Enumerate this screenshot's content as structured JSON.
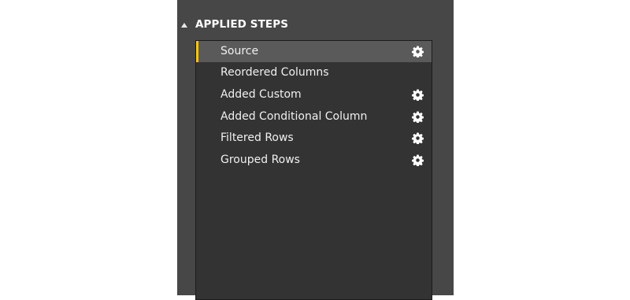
{
  "panel": {
    "title": "APPLIED STEPS",
    "collapse_icon": "triangle-up-icon",
    "accent_color": "#f2c811"
  },
  "steps": [
    {
      "label": "Source",
      "selected": true,
      "has_settings": true,
      "settings_icon": "gear-icon"
    },
    {
      "label": "Reordered Columns",
      "selected": false,
      "has_settings": false
    },
    {
      "label": "Added Custom",
      "selected": false,
      "has_settings": true,
      "settings_icon": "gear-icon"
    },
    {
      "label": "Added Conditional Column",
      "selected": false,
      "has_settings": true,
      "settings_icon": "gear-icon"
    },
    {
      "label": "Filtered Rows",
      "selected": false,
      "has_settings": true,
      "settings_icon": "gear-icon"
    },
    {
      "label": "Grouped Rows",
      "selected": false,
      "has_settings": true,
      "settings_icon": "gear-icon"
    }
  ]
}
